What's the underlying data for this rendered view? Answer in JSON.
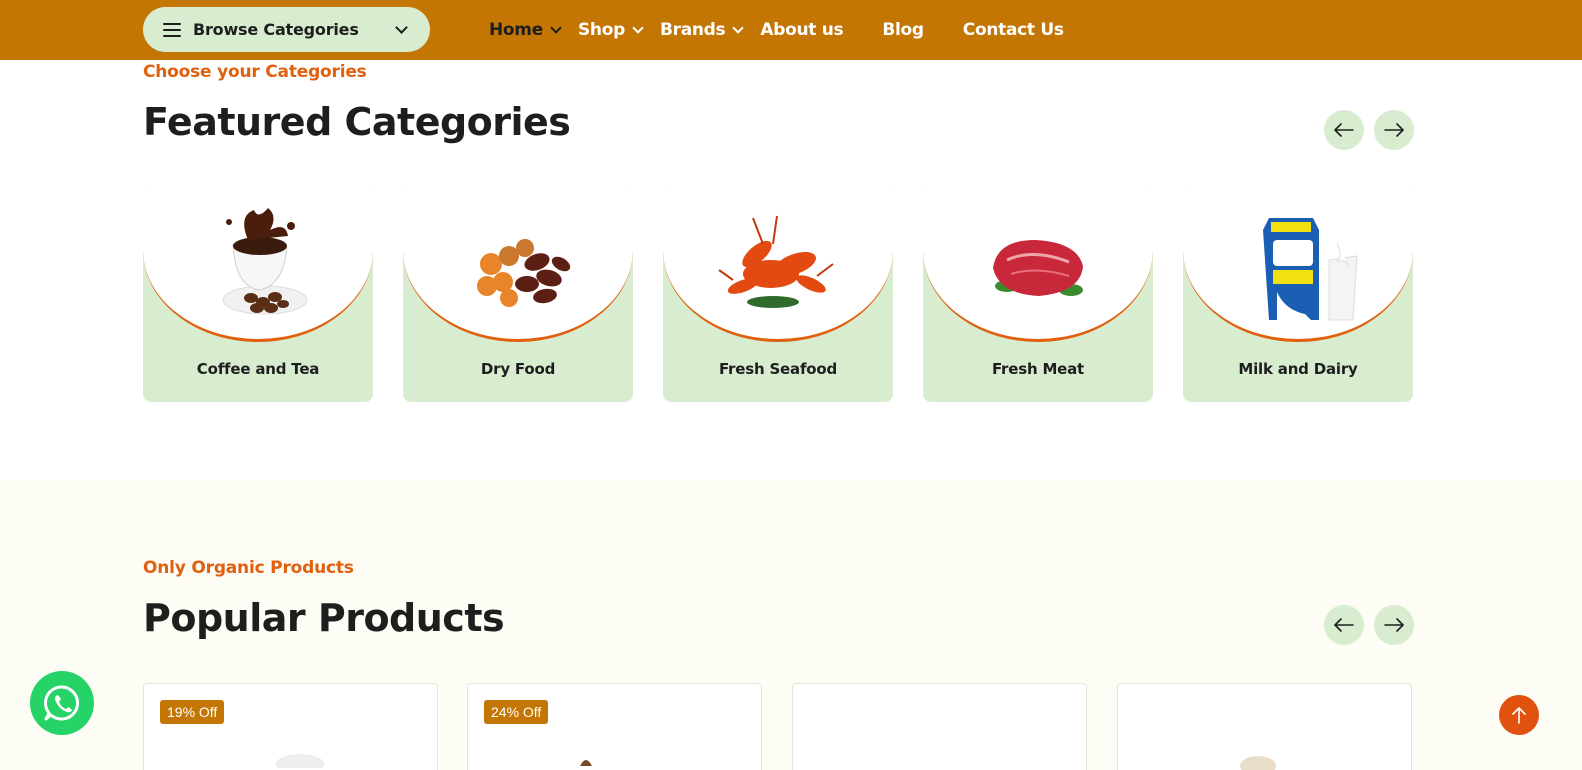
{
  "header": {
    "browse_label": "Browse Categories",
    "nav": [
      {
        "label": "Home",
        "dropdown": true,
        "active": true
      },
      {
        "label": "Shop",
        "dropdown": true
      },
      {
        "label": "Brands",
        "dropdown": true
      },
      {
        "label": "About us",
        "dropdown": false
      },
      {
        "label": "Blog",
        "dropdown": false
      },
      {
        "label": "Contact Us",
        "dropdown": false
      }
    ]
  },
  "featured": {
    "subtitle": "Choose your Categories",
    "title": "Featured Categories",
    "categories": [
      {
        "name": "Coffee and Tea"
      },
      {
        "name": "Dry Food"
      },
      {
        "name": "Fresh Seafood"
      },
      {
        "name": "Fresh Meat"
      },
      {
        "name": "Milk and Dairy"
      }
    ]
  },
  "popular": {
    "subtitle": "Only Organic Products",
    "title": "Popular Products",
    "products": [
      {
        "badge": "19% Off"
      },
      {
        "badge": "24% Off"
      },
      {
        "badge": ""
      },
      {
        "badge": ""
      }
    ]
  },
  "colors": {
    "brand": "#c47604",
    "accent": "#e0600e",
    "soft_green": "#d8ecd0",
    "whatsapp": "#25d366"
  }
}
